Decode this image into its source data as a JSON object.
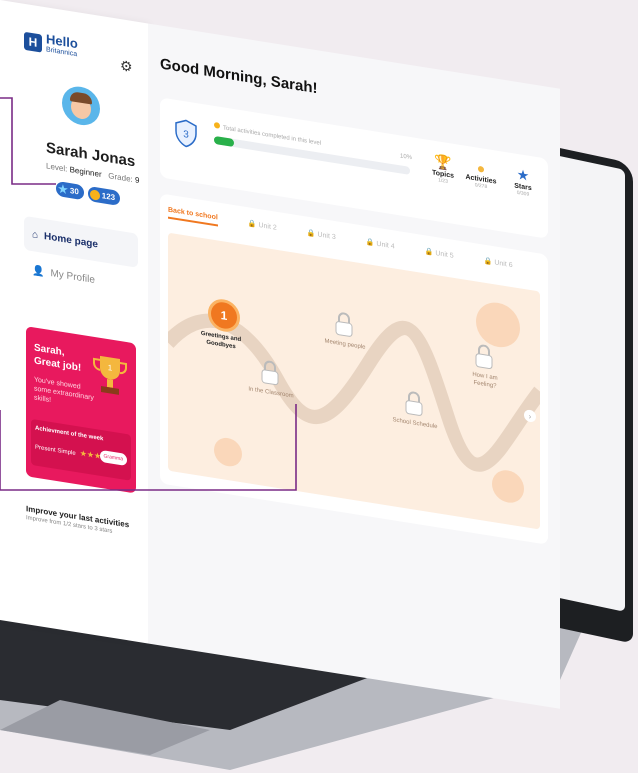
{
  "app": {
    "logo": {
      "brand": "Hello",
      "sub": "Britannica"
    },
    "user": {
      "name": "Sarah Jonas",
      "level_label": "Level:",
      "level_value": "Beginner",
      "grade_label": "Grade:",
      "grade_value": "9",
      "stars": "30",
      "coins": "123"
    },
    "nav": {
      "home": "Home page",
      "profile": "My Profile"
    },
    "promo": {
      "title": "Sarah, Great job!",
      "text": "You've showed some extraordinary skills!",
      "achievement_label": "Achievment of the week",
      "achievement_item": "Present Simple",
      "button": "Gramma"
    },
    "improve": {
      "title": "Improve your last activities",
      "subtitle": "Improve from 1/2 stars to 3 stars"
    },
    "greeting": "Good Morning, Sarah!",
    "progress": {
      "level_number": "3",
      "label": "Total activities completed in this level",
      "percent_text": "10%",
      "fraction": 0.1
    },
    "stats": [
      {
        "label": "Topics",
        "value": "1/23"
      },
      {
        "label": "Activities",
        "value": "0/278"
      },
      {
        "label": "Stars",
        "value": "0/309"
      }
    ],
    "tabs": [
      "Back to school",
      "Unit 2",
      "Unit 3",
      "Unit 4",
      "Unit 5",
      "Unit 6"
    ],
    "nodes": [
      {
        "number": "1",
        "label": "Greetings and Goodbyes"
      },
      {
        "label": "In the Classroom"
      },
      {
        "label": "Meeting people"
      },
      {
        "label": "School Schedule"
      },
      {
        "label": "How I am Feeling?"
      }
    ]
  },
  "colors": {
    "accent_pink": "#e8195e",
    "accent_orange": "#f07820",
    "brand_blue": "#1c4f9c",
    "callout_purple": "#7a2b86",
    "progress_green": "#29b04a"
  }
}
